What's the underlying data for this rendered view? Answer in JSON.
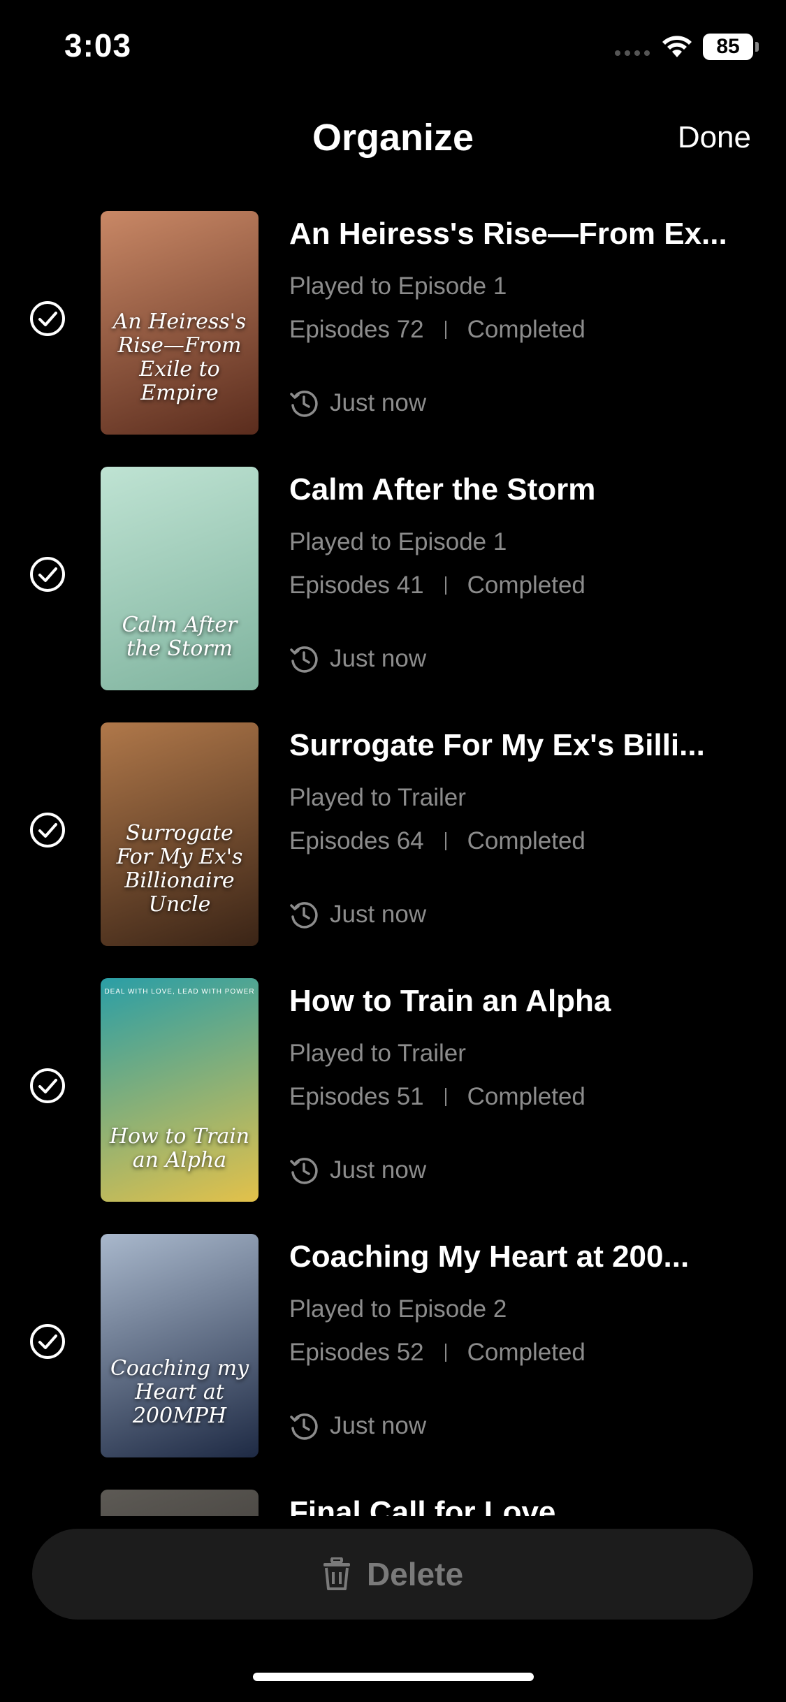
{
  "status_bar": {
    "time": "3:03",
    "battery": "85"
  },
  "header": {
    "title": "Organize",
    "done_label": "Done"
  },
  "items": [
    {
      "title": "An Heiress's Rise—From Ex...",
      "played": "Played to Episode 1",
      "episodes": "Episodes 72",
      "status": "Completed",
      "time": "Just now",
      "poster_text": "An Heiress's Rise—From Exile to Empire",
      "poster_colors": [
        "#c98866",
        "#5a2c1d"
      ]
    },
    {
      "title": "Calm After the Storm",
      "played": "Played to Episode 1",
      "episodes": "Episodes 41",
      "status": "Completed",
      "time": "Just now",
      "poster_text": "Calm After the Storm",
      "poster_colors": [
        "#bfe3d3",
        "#7fb39e"
      ]
    },
    {
      "title": "Surrogate For My Ex's Billi...",
      "played": "Played to Trailer",
      "episodes": "Episodes 64",
      "status": "Completed",
      "time": "Just now",
      "poster_text": "Surrogate For My Ex's Billionaire Uncle",
      "poster_colors": [
        "#b0784a",
        "#3a2416"
      ]
    },
    {
      "title": "How to Train an Alpha",
      "played": "Played to Trailer",
      "episodes": "Episodes 51",
      "status": "Completed",
      "time": "Just now",
      "poster_text": "How to Train an Alpha",
      "poster_tagline": "DEAL WITH LOVE, LEAD WITH POWER",
      "poster_colors": [
        "#2a9ea6",
        "#e3c14a"
      ]
    },
    {
      "title": "Coaching My Heart at 200...",
      "played": "Played to Episode 2",
      "episodes": "Episodes 52",
      "status": "Completed",
      "time": "Just now",
      "poster_text": "Coaching my Heart at 200MPH",
      "poster_colors": [
        "#a9b8cc",
        "#1e2a44"
      ]
    },
    {
      "title": "Final Call for Love",
      "played": "",
      "episodes": "",
      "status": "",
      "time": "",
      "poster_text": "",
      "poster_colors": [
        "#5d5a55",
        "#2a2724"
      ]
    }
  ],
  "footer": {
    "delete_label": "Delete"
  }
}
